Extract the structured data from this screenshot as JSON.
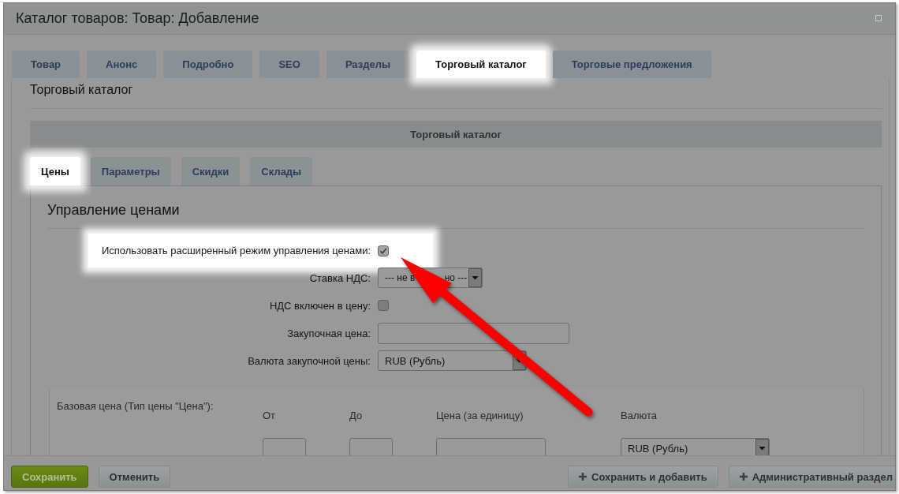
{
  "window": {
    "title": "Каталог товаров: Товар: Добавление"
  },
  "tabs": [
    {
      "label": "Товар",
      "selected": false
    },
    {
      "label": "Анонс",
      "selected": false
    },
    {
      "label": "Подробно",
      "selected": false
    },
    {
      "label": "SEO",
      "selected": false
    },
    {
      "label": "Разделы",
      "selected": false
    },
    {
      "label": "Торговый каталог",
      "selected": true
    },
    {
      "label": "Торговые предложения",
      "selected": false
    }
  ],
  "page_heading": "Торговый каталог",
  "section": {
    "title": "Торговый каталог"
  },
  "subtabs": [
    {
      "label": "Цены",
      "selected": true
    },
    {
      "label": "Параметры",
      "selected": false
    },
    {
      "label": "Скидки",
      "selected": false
    },
    {
      "label": "Склады",
      "selected": false
    }
  ],
  "price_management": {
    "title": "Управление ценами",
    "fields": [
      {
        "kind": "checkbox",
        "label": "Использовать расширенный режим управления ценами:",
        "checked": true,
        "highlighted": true
      },
      {
        "kind": "select",
        "label": "Ставка НДС:",
        "value_parts": [
          "--- не в",
          "но ---"
        ],
        "highlighted": false
      },
      {
        "kind": "checkbox",
        "label": "НДС включен в цену:",
        "checked": false,
        "highlighted": false
      },
      {
        "kind": "input",
        "label": "Закупочная цена:",
        "highlighted": false
      },
      {
        "kind": "select",
        "label": "Валюта закупочной цены:",
        "value_parts": [
          "RUB (Рубль)"
        ],
        "highlighted": false
      }
    ]
  },
  "base_price": {
    "label": "Базовая цена (Тип цены \"Цена\"):",
    "columns": [
      "От",
      "До",
      "Цена (за единицу)",
      "Валюта"
    ],
    "cells": [
      {
        "kind": "input"
      },
      {
        "kind": "input"
      },
      {
        "kind": "input"
      },
      {
        "kind": "select",
        "value": "RUB (Рубль)"
      }
    ]
  },
  "footer": {
    "left_buttons": [
      {
        "label": "Сохранить",
        "kind": "primary"
      },
      {
        "label": "Отменить",
        "kind": "plain"
      }
    ],
    "right_buttons": [
      {
        "label": "Сохранить и добавить",
        "kind": "add"
      },
      {
        "label": "Административный раздел",
        "kind": "add"
      }
    ]
  },
  "annotations": [
    {
      "kind": "arrow"
    }
  ]
}
